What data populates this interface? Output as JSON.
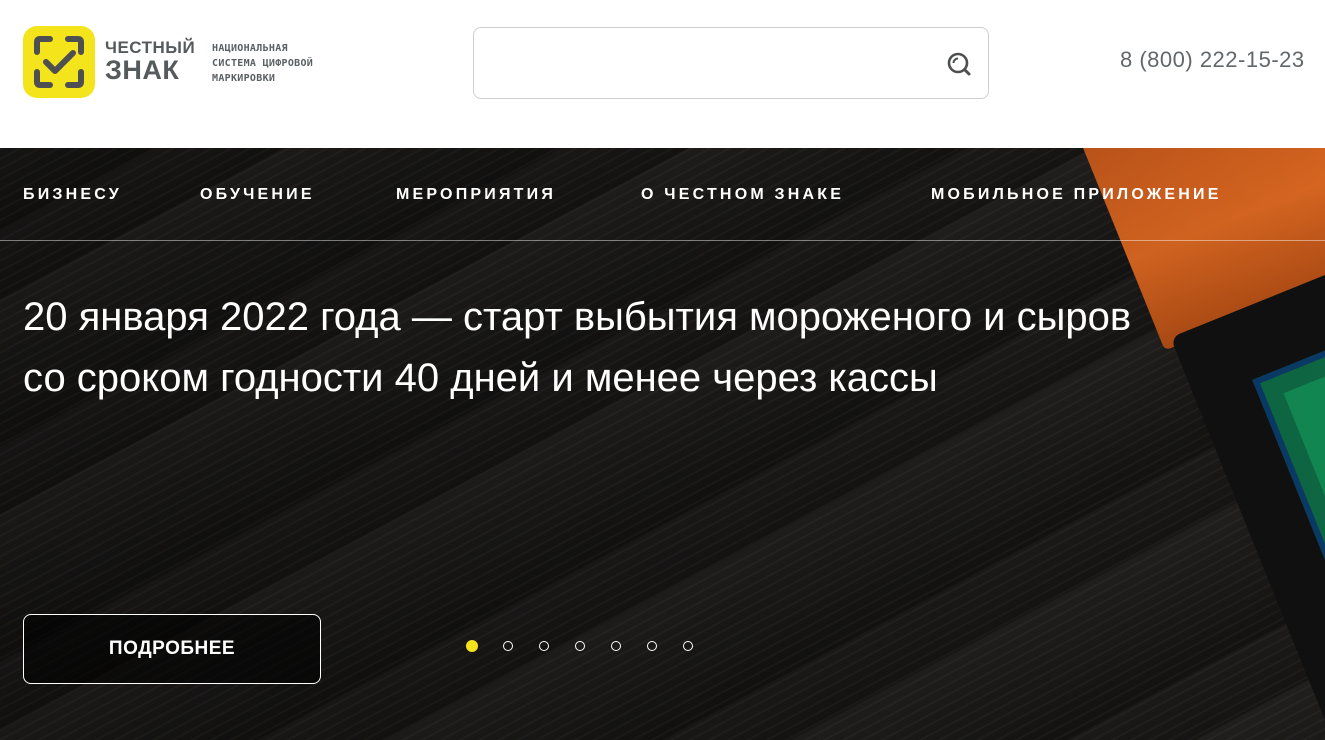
{
  "header": {
    "logo": {
      "name_line1": "ЧЕСТНЫЙ",
      "name_line2": "ЗНАК",
      "tagline": [
        "НАЦИОНАЛЬНАЯ",
        "СИСТЕМА ЦИФРОВОЙ",
        "МАРКИРОВКИ"
      ],
      "brand_color": "#f4e41c"
    },
    "search": {
      "value": "",
      "placeholder": "",
      "icon": "search-icon"
    },
    "phone": "8 (800) 222-15-23"
  },
  "nav": {
    "items": [
      {
        "label": "БИЗНЕСУ"
      },
      {
        "label": "ОБУЧЕНИЕ"
      },
      {
        "label": "МЕРОПРИЯТИЯ"
      },
      {
        "label": "О ЧЕСТНОМ ЗНАКЕ"
      },
      {
        "label": "МОБИЛЬНОЕ ПРИЛОЖЕНИЕ"
      }
    ]
  },
  "hero": {
    "title_lines": [
      "20 января 2022 года — старт выбытия мороженого и сыров",
      "со сроком годности 40 дней и менее через кассы"
    ],
    "button_label": "ПОДРОБНЕЕ",
    "slides_total": 7,
    "active_slide": 1,
    "active_dot_color": "#f4e41c"
  }
}
